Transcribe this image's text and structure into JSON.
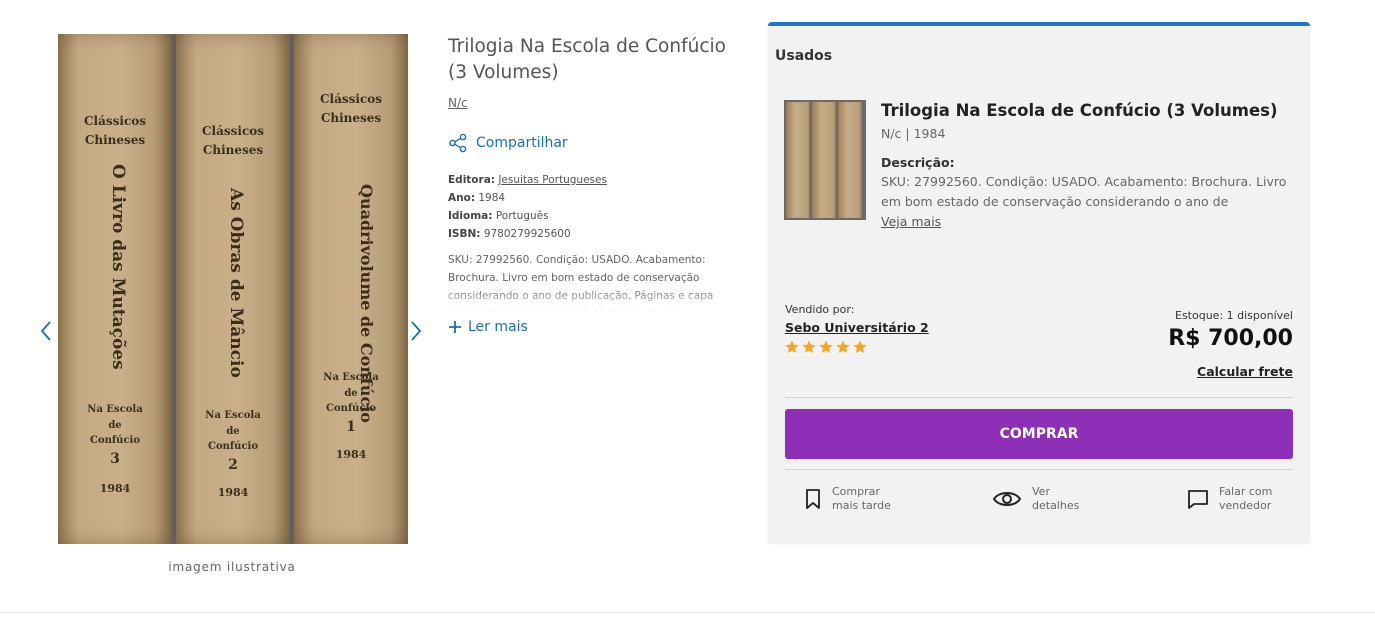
{
  "gallery": {
    "prev_icon": "chevron-left-icon",
    "next_icon": "chevron-right-icon",
    "caption": "imagem ilustrativa",
    "books": [
      {
        "head_1": "Clássicos",
        "head_2": "Chineses",
        "title": "O Livro das Mutações",
        "foot_1": "Na Escola",
        "foot_2": "de",
        "foot_3": "Confúcio",
        "number": "3",
        "year": "1984"
      },
      {
        "head_1": "Clássicos",
        "head_2": "Chineses",
        "title": "As Obras de Mâncio",
        "foot_1": "Na Escola",
        "foot_2": "de",
        "foot_3": "Confúcio",
        "number": "2",
        "year": "1984"
      },
      {
        "head_1": "Clássicos",
        "head_2": "Chineses",
        "title": "Quadrivolume de Confúcio",
        "foot_1": "Na Escola",
        "foot_2": "de",
        "foot_3": "Confúcio",
        "number": "1",
        "year": "1984"
      }
    ]
  },
  "product": {
    "title": "Trilogia Na Escola de Confúcio (3 Volumes)",
    "author": "N/c",
    "share_label": "Compartilhar",
    "share_icon": "share-icon",
    "details": {
      "publisher_label": "Editora:",
      "publisher": "Jesuitas Portugueses",
      "year_label": "Ano:",
      "year": "1984",
      "language_label": "Idioma:",
      "language": "Português",
      "isbn_label": "ISBN:",
      "isbn": "9780279925600"
    },
    "description": "SKU: 27992560. Condição: USADO. Acabamento: Brochura. Livro em bom estado de conservação considerando o ano de publicação. Páginas e capa apresentam marcas gerais do tempo de uso.",
    "read_more": "Ler mais",
    "read_more_icon": "plus-icon"
  },
  "offer": {
    "section_label": "Usados",
    "title": "Trilogia Na Escola de Confúcio (3 Volumes)",
    "subtitle": "N/c | 1984",
    "description_label": "Descrição:",
    "description": "SKU: 27992560. Condição: USADO. Acabamento: Brochura. Livro em bom estado de conservação considerando o ano de publicação.",
    "see_more": "Veja mais",
    "sold_by_label": "Vendido por:",
    "seller": "Sebo Universitário 2",
    "rating": 5,
    "rating_max": 5,
    "stock": "Estoque: 1 disponível",
    "price": "R$ 700,00",
    "freight": "Calcular frete",
    "buy_label": "COMPRAR",
    "accent_color": "#1f73c8",
    "buy_color": "#8e2fb8",
    "star_color": "#f5a623",
    "actions": [
      {
        "icon": "bookmark-icon",
        "line_1": "Comprar",
        "line_2": "mais tarde"
      },
      {
        "icon": "eye-icon",
        "line_1": "Ver",
        "line_2": "detalhes"
      },
      {
        "icon": "chat-icon",
        "line_1": "Falar com",
        "line_2": "vendedor"
      }
    ]
  }
}
